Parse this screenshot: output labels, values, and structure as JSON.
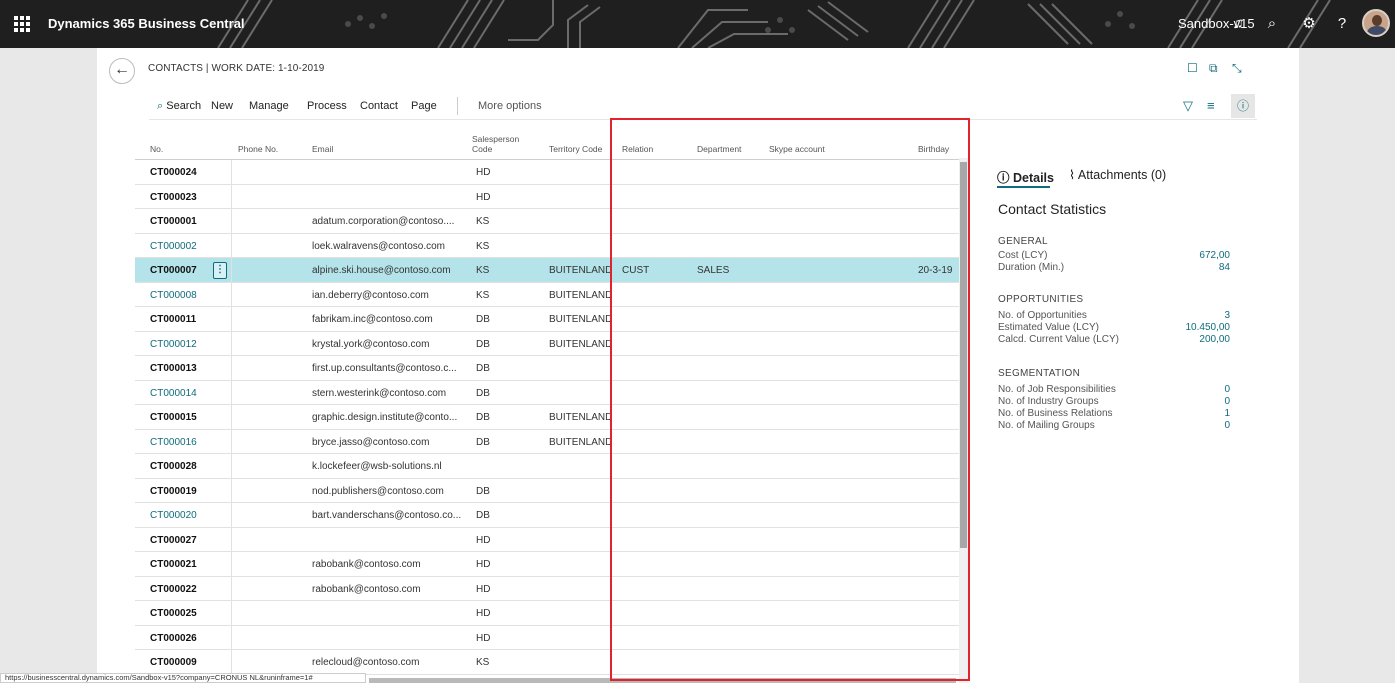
{
  "app": {
    "product_name": "Dynamics 365 Business Central",
    "environment": "Sandbox-v15"
  },
  "page": {
    "title": "CONTACTS | WORK DATE: 1-10-2019"
  },
  "actions": {
    "search": "Search",
    "new": "New",
    "manage": "Manage",
    "process": "Process",
    "contact": "Contact",
    "page": "Page",
    "more": "More options"
  },
  "columns": {
    "no": "No.",
    "phone": "Phone No.",
    "email": "Email",
    "salesperson": "Salesperson Code",
    "territory": "Territory Code",
    "relation": "Relation",
    "department": "Department",
    "skype": "Skype account",
    "birthday": "Birthday"
  },
  "rows": [
    {
      "no": "CT000024",
      "email": "",
      "sp": "HD",
      "terr": "",
      "rel": "",
      "dept": "",
      "bday": "",
      "bold": true
    },
    {
      "no": "CT000023",
      "email": "",
      "sp": "HD",
      "terr": "",
      "rel": "",
      "dept": "",
      "bday": "",
      "bold": true
    },
    {
      "no": "CT000001",
      "email": "adatum.corporation@contoso....",
      "sp": "KS",
      "terr": "",
      "rel": "",
      "dept": "",
      "bday": "",
      "bold": true
    },
    {
      "no": "CT000002",
      "email": "loek.walravens@contoso.com",
      "sp": "KS",
      "terr": "",
      "rel": "",
      "dept": "",
      "bday": "",
      "bold": false
    },
    {
      "no": "CT000007",
      "email": "alpine.ski.house@contoso.com",
      "sp": "KS",
      "terr": "BUITENLAND",
      "rel": "CUST",
      "dept": "SALES",
      "bday": "20-3-19",
      "bold": true,
      "selected": true
    },
    {
      "no": "CT000008",
      "email": "ian.deberry@contoso.com",
      "sp": "KS",
      "terr": "BUITENLAND",
      "rel": "",
      "dept": "",
      "bday": "",
      "bold": false
    },
    {
      "no": "CT000011",
      "email": "fabrikam.inc@contoso.com",
      "sp": "DB",
      "terr": "BUITENLAND",
      "rel": "",
      "dept": "",
      "bday": "",
      "bold": true
    },
    {
      "no": "CT000012",
      "email": "krystal.york@contoso.com",
      "sp": "DB",
      "terr": "BUITENLAND",
      "rel": "",
      "dept": "",
      "bday": "",
      "bold": false
    },
    {
      "no": "CT000013",
      "email": "first.up.consultants@contoso.c...",
      "sp": "DB",
      "terr": "",
      "rel": "",
      "dept": "",
      "bday": "",
      "bold": true
    },
    {
      "no": "CT000014",
      "email": "stern.westerink@contoso.com",
      "sp": "DB",
      "terr": "",
      "rel": "",
      "dept": "",
      "bday": "",
      "bold": false
    },
    {
      "no": "CT000015",
      "email": "graphic.design.institute@conto...",
      "sp": "DB",
      "terr": "BUITENLAND",
      "rel": "",
      "dept": "",
      "bday": "",
      "bold": true
    },
    {
      "no": "CT000016",
      "email": "bryce.jasso@contoso.com",
      "sp": "DB",
      "terr": "BUITENLAND",
      "rel": "",
      "dept": "",
      "bday": "",
      "bold": false
    },
    {
      "no": "CT000028",
      "email": "k.lockefeer@wsb-solutions.nl",
      "sp": "",
      "terr": "",
      "rel": "",
      "dept": "",
      "bday": "",
      "bold": true
    },
    {
      "no": "CT000019",
      "email": "nod.publishers@contoso.com",
      "sp": "DB",
      "terr": "",
      "rel": "",
      "dept": "",
      "bday": "",
      "bold": true
    },
    {
      "no": "CT000020",
      "email": "bart.vanderschans@contoso.co...",
      "sp": "DB",
      "terr": "",
      "rel": "",
      "dept": "",
      "bday": "",
      "bold": false
    },
    {
      "no": "CT000027",
      "email": "",
      "sp": "HD",
      "terr": "",
      "rel": "",
      "dept": "",
      "bday": "",
      "bold": true
    },
    {
      "no": "CT000021",
      "email": "rabobank@contoso.com",
      "sp": "HD",
      "terr": "",
      "rel": "",
      "dept": "",
      "bday": "",
      "bold": true
    },
    {
      "no": "CT000022",
      "email": "rabobank@contoso.com",
      "sp": "HD",
      "terr": "",
      "rel": "",
      "dept": "",
      "bday": "",
      "bold": true
    },
    {
      "no": "CT000025",
      "email": "",
      "sp": "HD",
      "terr": "",
      "rel": "",
      "dept": "",
      "bday": "",
      "bold": true
    },
    {
      "no": "CT000026",
      "email": "",
      "sp": "HD",
      "terr": "",
      "rel": "",
      "dept": "",
      "bday": "",
      "bold": true
    },
    {
      "no": "CT000009",
      "email": "relecloud@contoso.com",
      "sp": "KS",
      "terr": "",
      "rel": "",
      "dept": "",
      "bday": "",
      "bold": true
    }
  ],
  "factbox": {
    "tab_details": "ⓘ Details",
    "tab_attachments": "Attachments (0)",
    "title": "Contact Statistics",
    "general": {
      "heading": "GENERAL",
      "cost_label": "Cost (LCY)",
      "cost_value": "672,00",
      "duration_label": "Duration (Min.)",
      "duration_value": "84"
    },
    "opportunities": {
      "heading": "OPPORTUNITIES",
      "count_label": "No. of Opportunities",
      "count_value": "3",
      "est_label": "Estimated Value (LCY)",
      "est_value": "10.450,00",
      "calc_label": "Calcd. Current Value (LCY)",
      "calc_value": "200,00"
    },
    "segmentation": {
      "heading": "SEGMENTATION",
      "job_label": "No. of Job Responsibilities",
      "job_value": "0",
      "ind_label": "No. of Industry Groups",
      "ind_value": "0",
      "bus_label": "No. of Business Relations",
      "bus_value": "1",
      "mail_label": "No. of Mailing Groups",
      "mail_value": "0"
    }
  },
  "status_url": "https://businesscentral.dynamics.com/Sandbox-v15?company=CRONUS NL&runinframe=1#",
  "colors": {
    "accent": "#0f6c7c",
    "selected_row": "#b5e3ea",
    "highlight": "#e0232c",
    "appbar": "#1f1f1f"
  },
  "icons": [
    "waffle-icon",
    "bell-icon",
    "search-icon",
    "gear-icon",
    "help-icon",
    "back-arrow-icon",
    "bookmark-icon",
    "open-new-window-icon",
    "collapse-icon",
    "filter-icon",
    "list-view-icon",
    "info-icon",
    "paperclip-icon",
    "more-dots-icon"
  ]
}
